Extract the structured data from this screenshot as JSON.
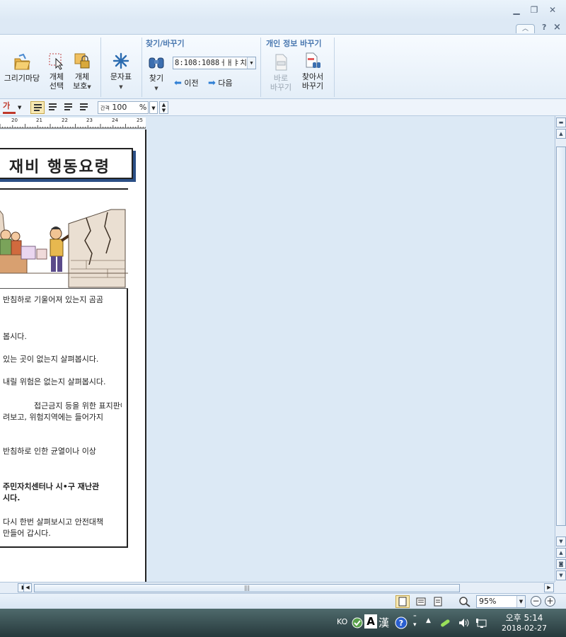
{
  "window": {
    "minimize_icon": "minimize-icon",
    "restore_icon": "restore-icon",
    "close_icon": "close-icon",
    "help_label": "?"
  },
  "ribbon": {
    "draw_gallery": "그리기마당",
    "object_select": [
      "개체",
      "선택"
    ],
    "object_protect": [
      "개체",
      "보호"
    ],
    "symbols": "문자표",
    "find_replace_title": "찾기/바꾸기",
    "find_label": "찾기",
    "find_value": "8:108:1088ㅓㅐㅑ치",
    "prev_label": "이전",
    "next_label": "다음",
    "personal_info_title": "개인 정보 바꾸기",
    "replace_now": [
      "바로",
      "바꾸기"
    ],
    "find_and_replace": [
      "찾아서",
      "바꾸기"
    ]
  },
  "formatbar": {
    "font_color_char": "가",
    "spacing_label": "간격",
    "spacing_value": "100",
    "spacing_unit": "%"
  },
  "ruler": {
    "numbers": [
      "20",
      "21",
      "22",
      "23",
      "24",
      "25"
    ]
  },
  "document": {
    "banner_title": "재비 행동요령",
    "lines": [
      {
        "text": "반침하로 기울어져 있는지 곰곰",
        "bold": false
      },
      {
        "text": "봅시다.",
        "bold": false
      },
      {
        "text": "있는 곳이 없는지 살펴봅시다.",
        "bold": false
      },
      {
        "text": "내릴 위험은 없는지 살펴봅시다.",
        "bold": false
      },
      {
        "text": "접근금지 등을 위한 표지판이",
        "bold": false
      },
      {
        "text": "려보고, 위험지역에는 들어가지",
        "bold": false
      },
      {
        "text": "반침하로 인한 균열이나 이상",
        "bold": false
      },
      {
        "text": "주민자치센터나 시•구 재난관",
        "bold": true
      },
      {
        "text": "시다.",
        "bold": true
      },
      {
        "text": "다시 한번 살펴보시고 안전대책",
        "bold": false
      },
      {
        "text": "만들어 갑시다.",
        "bold": false
      }
    ]
  },
  "statusbar": {
    "zoom_value": "95%"
  },
  "taskbar": {
    "ime_lang": "KO",
    "ime_mode": "A",
    "hanja": "漢",
    "clock_time": "오후 5:14",
    "clock_date": "2018-02-27"
  }
}
